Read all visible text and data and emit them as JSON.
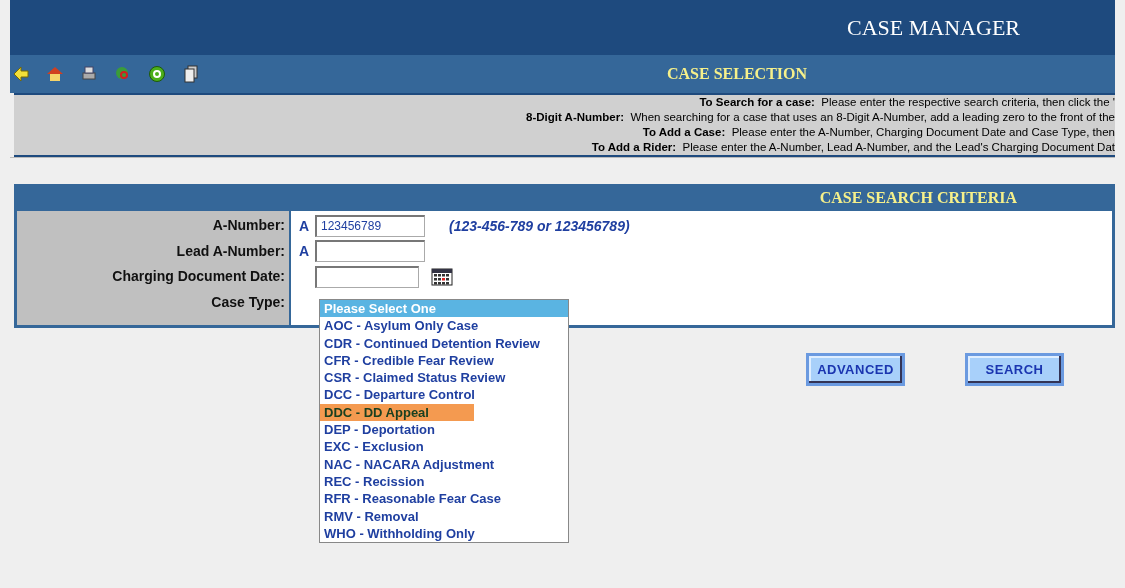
{
  "window": {
    "title": "CASE MANAGER"
  },
  "toolbar": {
    "title": "CASE SELECTION"
  },
  "instructions": [
    {
      "label": "To Search for a case:",
      "text": "Please enter the respective search criteria, then click the '"
    },
    {
      "label": "8-Digit A-Number:",
      "text": "When searching for a case that uses an 8-Digit A-Number, add a leading zero to the front of the"
    },
    {
      "label": "To Add a Case:",
      "text": "Please enter the A-Number, Charging Document Date and Case Type, then"
    },
    {
      "label": "To Add a Rider:",
      "text": "Please enter the A-Number, Lead A-Number, and the Lead's Charging Document Dat"
    }
  ],
  "search_criteria": {
    "title": "CASE SEARCH CRITERIA",
    "fields": [
      {
        "label": "A-Number:",
        "kind": "anumber",
        "prefix": "A",
        "value": "123456789",
        "hint": "(123-456-789 or 123456789)"
      },
      {
        "label": "Lead A-Number:",
        "kind": "anumber",
        "prefix": "A"
      },
      {
        "label": "Charging Document Date:",
        "kind": "date"
      },
      {
        "label": "Case Type:",
        "kind": "select"
      }
    ]
  },
  "case_type_options": [
    {
      "label": "Please Select One",
      "selected": true,
      "hovered": false
    },
    {
      "label": "AOC - Asylum Only Case",
      "selected": false,
      "hovered": false
    },
    {
      "label": "CDR - Continued Detention Review",
      "selected": false,
      "hovered": false
    },
    {
      "label": "CFR - Credible Fear Review",
      "selected": false,
      "hovered": false
    },
    {
      "label": "CSR - Claimed Status Review",
      "selected": false,
      "hovered": false
    },
    {
      "label": "DCC - Departure Control",
      "selected": false,
      "hovered": false
    },
    {
      "label": "DDC - DD Appeal",
      "selected": false,
      "hovered": true
    },
    {
      "label": "DEP - Deportation",
      "selected": false,
      "hovered": false
    },
    {
      "label": "EXC - Exclusion",
      "selected": false,
      "hovered": false
    },
    {
      "label": "NAC - NACARA Adjustment",
      "selected": false,
      "hovered": false
    },
    {
      "label": "REC - Recission",
      "selected": false,
      "hovered": false
    },
    {
      "label": "RFR - Reasonable Fear Case",
      "selected": false,
      "hovered": false
    },
    {
      "label": "RMV - Removal",
      "selected": false,
      "hovered": false
    },
    {
      "label": "WHO - Withholding Only",
      "selected": false,
      "hovered": false
    }
  ],
  "buttons": [
    "ADVANCED",
    "SEARCH"
  ]
}
